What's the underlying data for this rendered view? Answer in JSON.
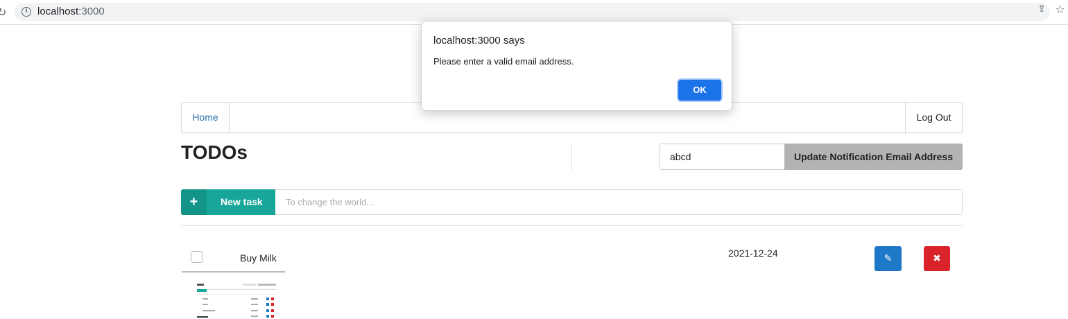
{
  "browser": {
    "url_host": "localhost",
    "url_port": ":3000"
  },
  "navbar": {
    "home_label": "Home",
    "logout_label": "Log Out"
  },
  "page": {
    "title": "TODOs",
    "email_value": "abcd",
    "update_email_label": "Update Notification Email Address"
  },
  "new_task": {
    "plus": "+",
    "label": "New task",
    "placeholder": "To change the world..."
  },
  "todos": [
    {
      "text": "Buy Milk",
      "date": "2021-12-24",
      "done": false
    }
  ],
  "alert": {
    "title": "localhost:3000 says",
    "message": "Please enter a valid email address.",
    "ok_label": "OK"
  },
  "colors": {
    "teal": "#18a69a",
    "edit_blue": "#1e78c8",
    "delete_red": "#d9222a",
    "dialog_blue": "#1a73e8"
  },
  "icons": {
    "reload": "reload-icon",
    "info": "info-icon",
    "share": "share-icon",
    "star": "star-icon",
    "plus": "plus-icon",
    "edit": "pencil-icon",
    "delete": "close-icon"
  }
}
